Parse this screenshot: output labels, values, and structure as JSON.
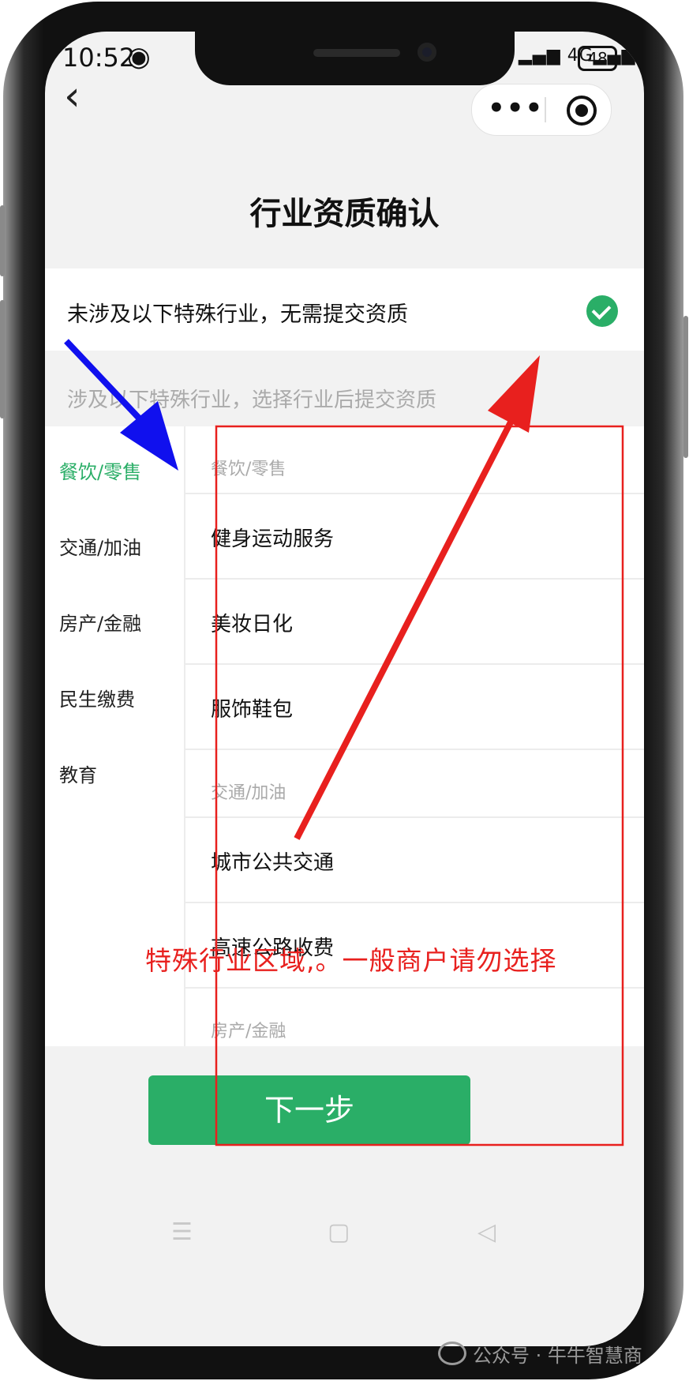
{
  "status_bar": {
    "time": "10:52",
    "eye_icon": "eye-icon",
    "network": "4G",
    "battery": "48"
  },
  "nav": {
    "back_icon": "back-chevron-icon",
    "more_icon": "more-dots-icon",
    "close_icon": "target-close-icon"
  },
  "page_title": "行业资质确认",
  "no_special_option": {
    "label": "未涉及以下特殊行业，无需提交资质",
    "checked": true
  },
  "section_hint": "涉及以下特殊行业，选择行业后提交资质",
  "sidebar": {
    "items": [
      {
        "label": "餐饮/零售",
        "active": true
      },
      {
        "label": "交通/加油",
        "active": false
      },
      {
        "label": "房产/金融",
        "active": false
      },
      {
        "label": "民生缴费",
        "active": false
      },
      {
        "label": "教育",
        "active": false
      }
    ]
  },
  "list": {
    "group_dining_retail": "餐饮/零售",
    "fitness_service": "健身运动服务",
    "cosmetics": "美妆日化",
    "apparel_bags": "服饰鞋包",
    "group_transport_fuel": "交通/加油",
    "city_transit": "城市公共交通",
    "highway_toll": "高速公路收费",
    "group_property_finance": "房产/金融"
  },
  "next_button": "下一步",
  "annotation": "特殊行业区域,。一般商户请勿选择",
  "watermark": "公众号 · 牛牛智慧商",
  "colors": {
    "accent_green": "#2aae67",
    "annotation_red": "#e8201e",
    "arrow_blue": "#1010ee"
  }
}
